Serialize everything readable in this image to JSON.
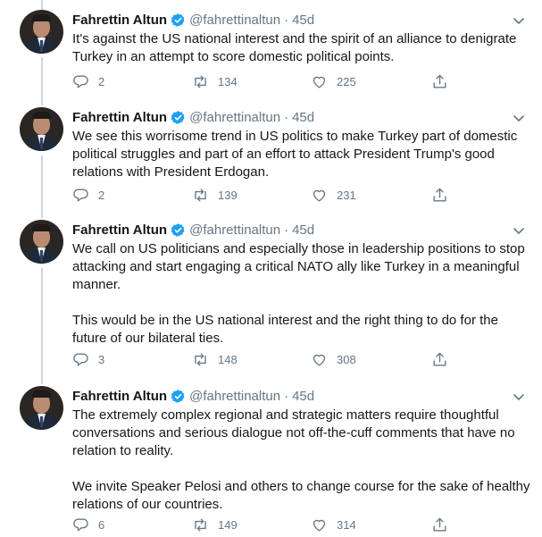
{
  "author": {
    "name": "Fahrettin Altun",
    "handle": "@fahrettinaltun",
    "time": "45d",
    "separator": "·"
  },
  "tweets": [
    {
      "paragraphs": [
        "It's against the US national interest and the spirit of an alliance to denigrate Turkey  in an attempt to score domestic political points."
      ],
      "replies": "2",
      "retweets": "134",
      "likes": "225"
    },
    {
      "paragraphs": [
        "We see this worrisome trend in US politics to make Turkey part of domestic political struggles and part of an effort to attack President Trump's good relations with President Erdogan."
      ],
      "replies": "2",
      "retweets": "139",
      "likes": "231"
    },
    {
      "paragraphs": [
        "We call on US politicians and especially those in leadership positions to stop attacking and start engaging a critical NATO ally like Turkey in a meaningful manner.",
        "This would be in the US national interest and the right thing to do for the future of our bilateral ties."
      ],
      "replies": "3",
      "retweets": "148",
      "likes": "308"
    },
    {
      "paragraphs": [
        "The extremely complex regional and strategic matters require thoughtful conversations and serious dialogue not off-the-cuff comments that have no relation to reality.",
        "We invite Speaker Pelosi and others to change course for the sake of healthy relations of our countries."
      ],
      "replies": "6",
      "retweets": "149",
      "likes": "314"
    }
  ],
  "icons": {
    "verified": "verified-badge-icon",
    "more": "chevron-down-icon",
    "reply": "reply-icon",
    "retweet": "retweet-icon",
    "like": "heart-icon",
    "share": "share-icon"
  },
  "colors": {
    "accent": "#1da1f2",
    "text": "#14171a",
    "muted": "#657786",
    "thread_line": "#ccd6dd"
  }
}
